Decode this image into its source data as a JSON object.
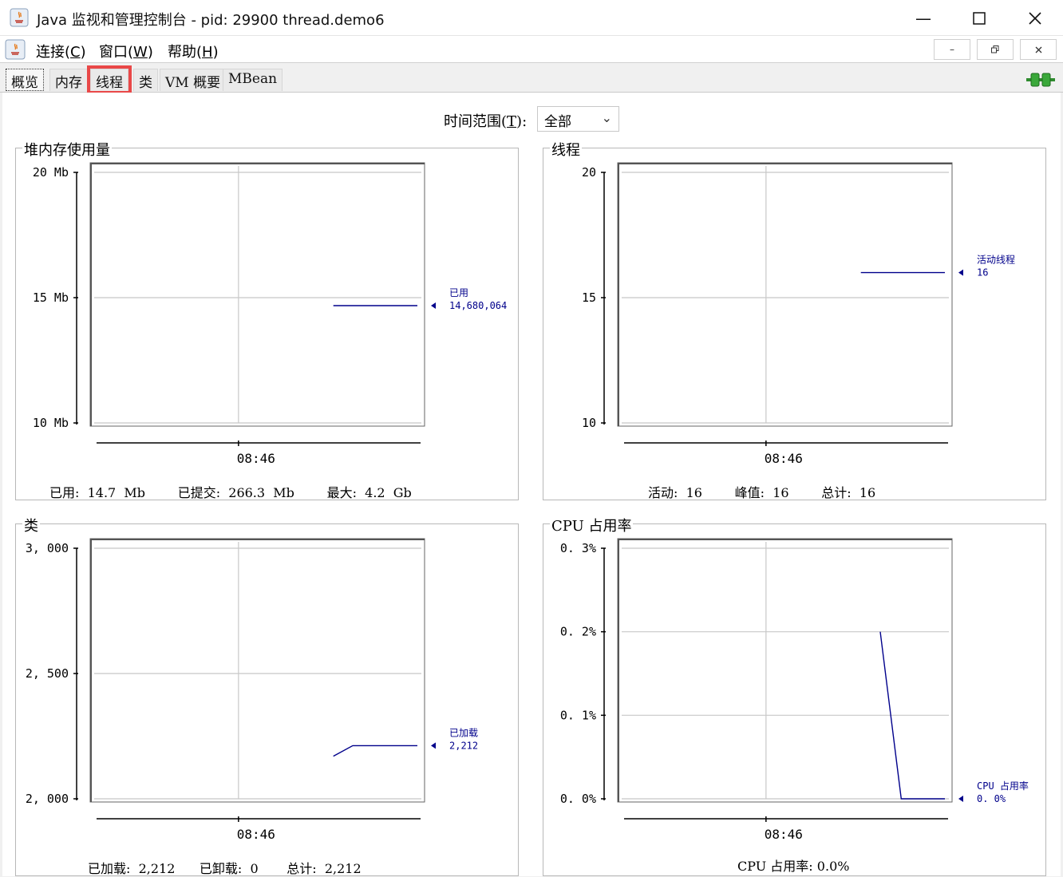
{
  "window": {
    "title": "Java 监视和管理控制台 - pid: 29900 thread.demo6"
  },
  "menu": {
    "connect": {
      "label": "连接(",
      "key": "C",
      "end": ")"
    },
    "window": {
      "label": "窗口(",
      "key": "W",
      "end": ")"
    },
    "help": {
      "label": "帮助(",
      "key": "H",
      "end": ")"
    }
  },
  "tabs": [
    "概览",
    "内存",
    "线程",
    "类",
    "VM 概要",
    "MBean"
  ],
  "time_range": {
    "label": "时间范围(",
    "key": "T",
    "end": "):",
    "value": "全部"
  },
  "colors": {
    "line": "#00008b",
    "highlight": "#e94848",
    "grid": "#c8c8c8"
  },
  "panels": {
    "heap": {
      "title": "堆内存使用量",
      "stats": {
        "used_label": "已用:",
        "used": "14.7  Mb",
        "committed_label": "已提交:",
        "committed": "266.3  Mb",
        "max_label": "最大:",
        "max": "4.2  Gb"
      }
    },
    "threads": {
      "title": "线程",
      "stats": {
        "live_label": "活动:",
        "live": "16",
        "peak_label": "峰值:",
        "peak": "16",
        "total_label": "总计:",
        "total": "16"
      }
    },
    "classes": {
      "title": "类",
      "stats": {
        "loaded_label": "已加载:",
        "loaded": "2,212",
        "unloaded_label": "已卸载:",
        "unloaded": "0",
        "total_label": "总计:",
        "total": "2,212"
      }
    },
    "cpu": {
      "title": "CPU 占用率",
      "stats": {
        "label": "CPU 占用率:",
        "value": "0.0%"
      }
    }
  },
  "chart_data": [
    {
      "type": "line",
      "name": "heap",
      "y_ticks": [
        "20 Mb",
        "15 Mb",
        "10 Mb"
      ],
      "ylim": [
        10,
        20
      ],
      "x_ticks": [
        "08:46"
      ],
      "series": [
        {
          "name": "已用",
          "value_label": "14,680,064",
          "points": [
            [
              0.74,
              14.68
            ],
            [
              1.0,
              14.68
            ]
          ]
        }
      ]
    },
    {
      "type": "line",
      "name": "threads",
      "y_ticks": [
        "20",
        "15",
        "10"
      ],
      "ylim": [
        10,
        20
      ],
      "x_ticks": [
        "08:46"
      ],
      "series": [
        {
          "name": "活动线程",
          "value_label": "16",
          "points": [
            [
              0.74,
              16
            ],
            [
              1.0,
              16
            ]
          ]
        }
      ]
    },
    {
      "type": "line",
      "name": "classes",
      "y_ticks": [
        "3, 000",
        "2, 500",
        "2, 000"
      ],
      "ylim": [
        2000,
        3000
      ],
      "x_ticks": [
        "08:46"
      ],
      "series": [
        {
          "name": "已加载",
          "value_label": "2,212",
          "points": [
            [
              0.74,
              2170
            ],
            [
              0.8,
              2212
            ],
            [
              1.0,
              2212
            ]
          ]
        }
      ]
    },
    {
      "type": "line",
      "name": "cpu",
      "y_ticks": [
        "0. 3%",
        "0. 2%",
        "0. 1%",
        "0. 0%"
      ],
      "ylim": [
        0,
        0.3
      ],
      "x_ticks": [
        "08:46"
      ],
      "series": [
        {
          "name": "CPU 占用率",
          "value_label": "0. 0%",
          "points": [
            [
              0.8,
              0.2
            ],
            [
              0.865,
              0.0
            ],
            [
              1.0,
              0.0
            ]
          ]
        }
      ]
    }
  ]
}
